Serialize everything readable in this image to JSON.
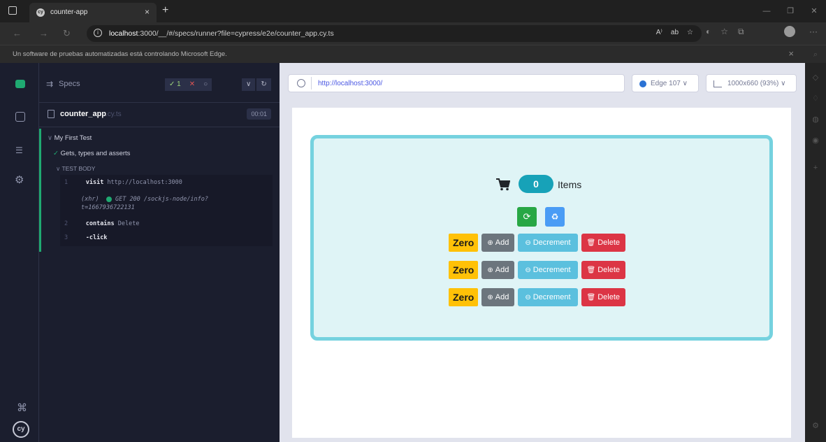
{
  "browser": {
    "tab_title": "counter-app",
    "tab_close": "×",
    "new_tab": "+",
    "url_host": "localhost",
    "url_rest": ":3000/__/#/specs/runner?file=cypress/e2e/counter_app.cy.ts",
    "infobar_message": "Un software de pruebas automatizadas está controlando Microsoft Edge.",
    "infobar_close": "×"
  },
  "specs": {
    "header_label": "Specs",
    "pass_count": "✓ 1",
    "fail_count": "✕",
    "pending_count": "○",
    "spec_name": "counter_app",
    "spec_ext": ".cy.ts",
    "duration": "00:01",
    "suite_title": "My First Test",
    "test_title": "Gets, types and asserts",
    "test_body_label": "TEST BODY",
    "commands": [
      {
        "num": "1",
        "name": "visit",
        "arg": "http://localhost:3000"
      },
      {
        "num": "",
        "name": "(xhr)",
        "arg": "GET 200 /sockjs-node/info?",
        "arg2": "t=1667936722131"
      },
      {
        "num": "2",
        "name": "contains",
        "arg": "Delete"
      },
      {
        "num": "3",
        "name": "-click",
        "arg": ""
      }
    ]
  },
  "aut": {
    "url": "http://localhost:3000/",
    "browser": "Edge 107",
    "viewport": "1000x660 (93%)"
  },
  "app": {
    "count": "0",
    "items_label": "Items",
    "rows": [
      {
        "badge": "Zero",
        "add": "Add",
        "dec": "Decrement",
        "del": "Delete"
      },
      {
        "badge": "Zero",
        "add": "Add",
        "dec": "Decrement",
        "del": "Delete"
      },
      {
        "badge": "Zero",
        "add": "Add",
        "dec": "Decrement",
        "del": "Delete"
      }
    ]
  },
  "colors": {
    "cypress_bg": "#1b1e2e",
    "pass_green": "#1fa971",
    "app_border": "#75d2df",
    "badge_warning": "#ffc107",
    "danger": "#dc3545"
  }
}
